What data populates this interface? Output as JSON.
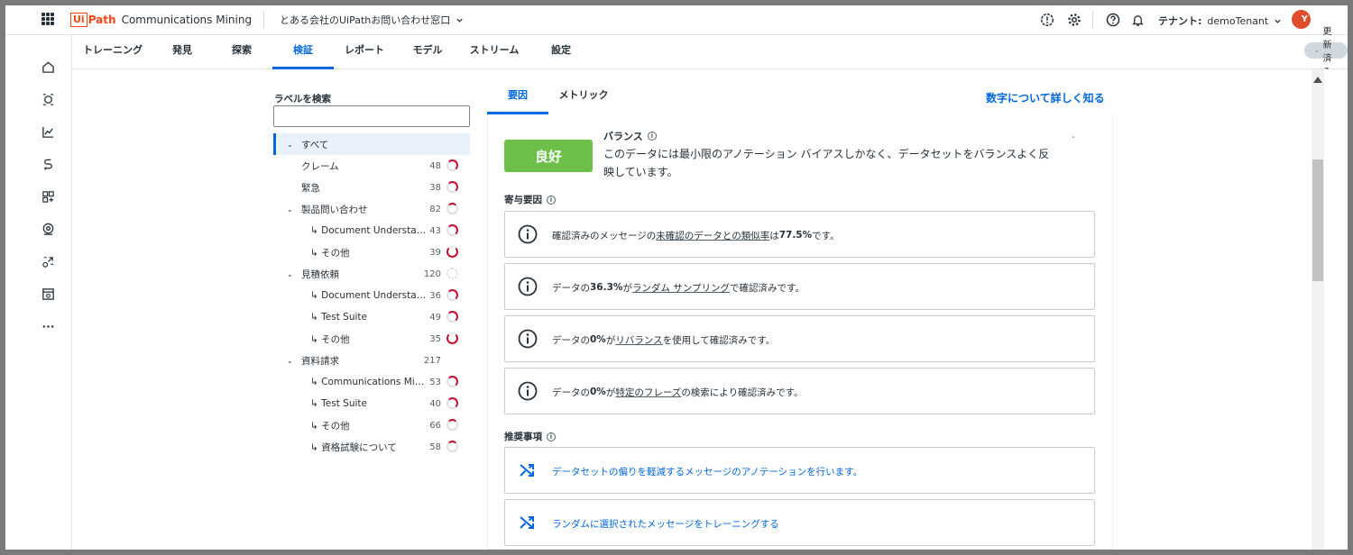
{
  "app": {
    "brand_ui": "Ui",
    "brand_path": "Path",
    "product": "Communications Mining",
    "project": "とある会社のUiPathお問い合わせ窓口",
    "tenant_label": "テナント:",
    "tenant_name": "demoTenant",
    "avatar_letter": "Y"
  },
  "nav": {
    "tabs": [
      "トレーニング",
      "発見",
      "探索",
      "検証",
      "レポート",
      "モデル",
      "ストリーム",
      "設定"
    ],
    "active_tab": "検証",
    "updated_label": "更新済み"
  },
  "labels": {
    "search_title": "ラベルを検索",
    "search_value": "",
    "tree": [
      {
        "label": "すべて",
        "count": "",
        "level": 0,
        "expandable": true,
        "selected": true
      },
      {
        "label": "クレーム",
        "count": "48",
        "level": 0,
        "expandable": false
      },
      {
        "label": "緊急",
        "count": "38",
        "level": 0,
        "expandable": false
      },
      {
        "label": "製品問い合わせ",
        "count": "82",
        "level": 0,
        "expandable": true
      },
      {
        "label": "↳ Document Understan...",
        "count": "43",
        "level": 1
      },
      {
        "label": "↳ その他",
        "count": "39",
        "level": 1
      },
      {
        "label": "見積依頼",
        "count": "120",
        "level": 0,
        "expandable": true
      },
      {
        "label": "↳ Document Understan...",
        "count": "36",
        "level": 1
      },
      {
        "label": "↳ Test Suite",
        "count": "49",
        "level": 1
      },
      {
        "label": "↳ その他",
        "count": "35",
        "level": 1
      },
      {
        "label": "資料請求",
        "count": "217",
        "level": 0,
        "expandable": true
      },
      {
        "label": "↳ Communications Mini...",
        "count": "53",
        "level": 1
      },
      {
        "label": "↳ Test Suite",
        "count": "40",
        "level": 1
      },
      {
        "label": "↳ その他",
        "count": "66",
        "level": 1
      },
      {
        "label": "↳ 資格試験について",
        "count": "58",
        "level": 1
      }
    ]
  },
  "panel": {
    "tabs": [
      "要因",
      "メトリック"
    ],
    "active_tab": "要因",
    "learn_more": "数字について詳しく知る",
    "rating": "良好",
    "balance_title": "バランス",
    "balance_desc": "このデータには最小限のアノテーション バイアスしかなく、データセットをバランスよく反映しています。",
    "dash": "-",
    "factors_title": "寄与要因",
    "factors": [
      {
        "pre": "確認済みのメッセージの",
        "link": "未確認のデータとの類似率",
        "mid": "は ",
        "value": "77.5%",
        "post": " です。"
      },
      {
        "pre": "データの ",
        "value": "36.3%",
        "mid": " が",
        "link": "ランダム サンプリング",
        "post": "で確認済みです。"
      },
      {
        "pre": "データの ",
        "value": "0%",
        "mid": " が",
        "link": "リバランス",
        "post": "を使用して確認済みです。"
      },
      {
        "pre": "データの ",
        "value": "0%",
        "mid": " が",
        "link": "特定のフレーズ",
        "post": "の検索により確認済みです。"
      }
    ],
    "recs_title": "推奨事項",
    "recs": [
      "データセットの偏りを軽減するメッセージのアノテーションを行います。",
      "ランダムに選択されたメッセージをトレーニングする"
    ]
  }
}
